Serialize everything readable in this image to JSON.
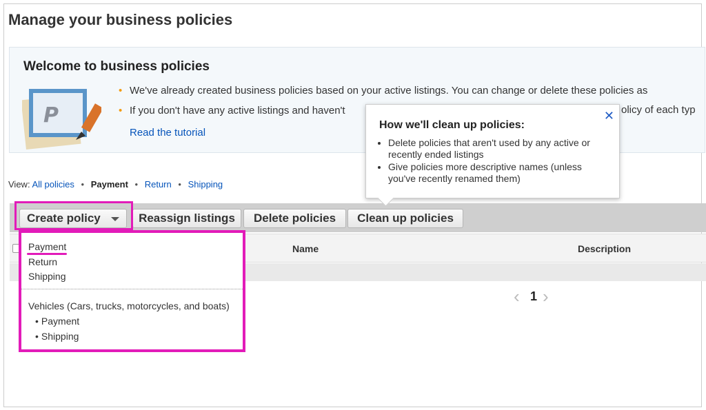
{
  "page": {
    "title": "Manage your business policies"
  },
  "welcome": {
    "title": "Welcome to business policies",
    "bullets": [
      "We've already created business policies based on your active listings. You can change or delete these policies as",
      "If you don't have any active listings and haven't"
    ],
    "bullet2_tail": "olicy of each typ",
    "tutorial_link": "Read the tutorial"
  },
  "view_filter": {
    "prefix": "View:",
    "options": [
      "All policies",
      "Payment",
      "Return",
      "Shipping"
    ],
    "current": "Payment",
    "separator": "•"
  },
  "toolbar": {
    "create_label": "Create policy",
    "reassign_label": "Reassign listings",
    "delete_label": "Delete policies",
    "cleanup_label": "Clean up policies"
  },
  "table": {
    "columns": [
      "Name",
      "Description"
    ]
  },
  "pager": {
    "current_page": "1",
    "prev": "‹",
    "next": "›"
  },
  "create_menu": {
    "items": [
      "Payment",
      "Return",
      "Shipping"
    ],
    "vehicles_header": "Vehicles (Cars, trucks, motorcycles, and boats)",
    "vehicle_items": [
      "Payment",
      "Shipping"
    ]
  },
  "tooltip": {
    "title": "How we'll clean up policies:",
    "items": [
      "Delete policies that aren't used by any active or recently ended listings",
      "Give policies more descriptive names (unless you've recently renamed them)"
    ],
    "close_glyph": "✕"
  },
  "colors": {
    "link": "#0654ba",
    "highlight": "#e21bb9",
    "bullet": "#f39c12"
  }
}
